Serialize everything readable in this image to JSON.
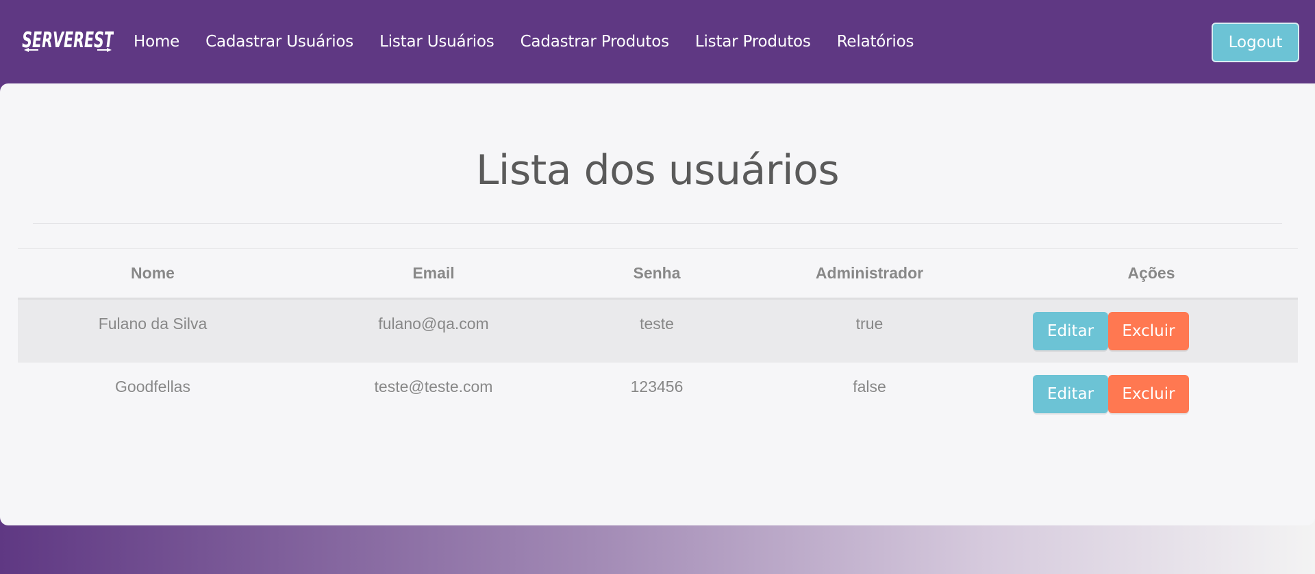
{
  "navbar": {
    "brand": "SERVEREST",
    "links": [
      "Home",
      "Cadastrar Usuários",
      "Listar Usuários",
      "Cadastrar Produtos",
      "Listar Produtos",
      "Relatórios"
    ],
    "logout_label": "Logout"
  },
  "main": {
    "title": "Lista dos usuários",
    "table": {
      "headers": [
        "Nome",
        "Email",
        "Senha",
        "Administrador",
        "Ações"
      ],
      "rows": [
        {
          "nome": "Fulano da Silva",
          "email": "fulano@qa.com",
          "senha": "teste",
          "administrador": "true",
          "edit_label": "Editar",
          "delete_label": "Excluir"
        },
        {
          "nome": "Goodfellas",
          "email": "teste@teste.com",
          "senha": "123456",
          "administrador": "false",
          "edit_label": "Editar",
          "delete_label": "Excluir"
        }
      ]
    }
  },
  "colors": {
    "primary": "#5f3883",
    "info": "#6cc3d5",
    "danger": "#ff7851",
    "panel": "#f6f6f8"
  }
}
